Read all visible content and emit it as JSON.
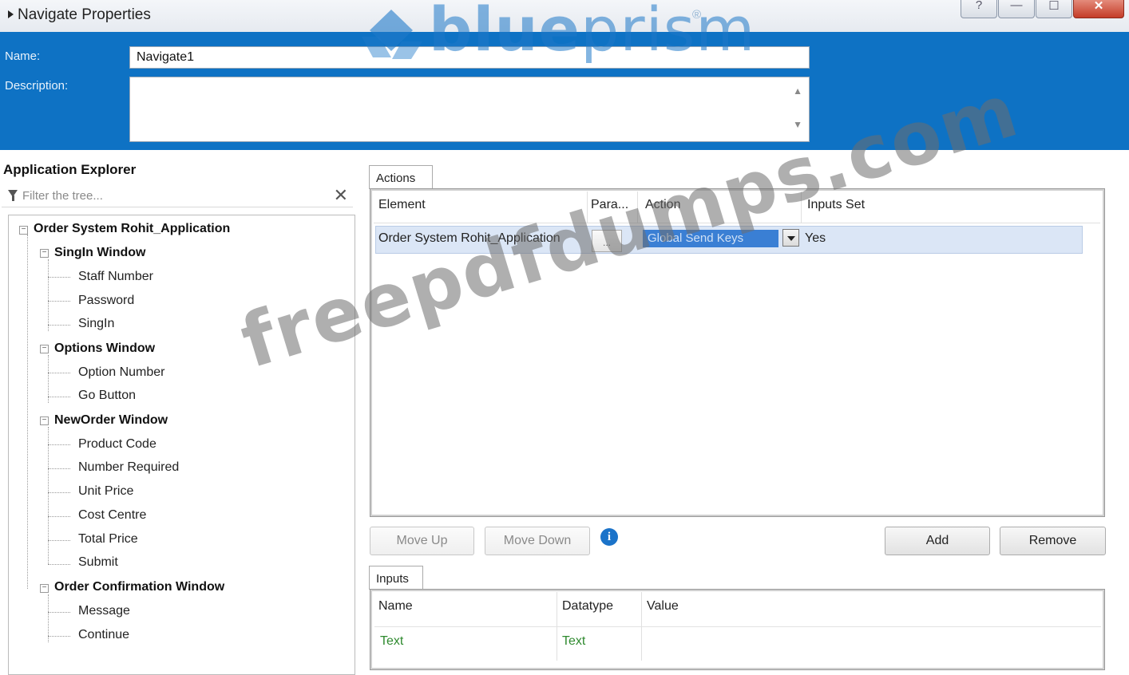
{
  "window": {
    "title": "Navigate Properties",
    "buttons": {
      "help": "?",
      "minimize": "—",
      "maximize": "☐",
      "close": "✕"
    }
  },
  "header": {
    "name_label": "Name:",
    "name_value": "Navigate1",
    "description_label": "Description:",
    "description_value": "",
    "logo": {
      "part1": "blue",
      "part2": "prism",
      "reg": "®"
    }
  },
  "explorer": {
    "title": "Application Explorer",
    "filter_placeholder": "Filter the tree...",
    "filter_clear": "✕",
    "root": "Order System Rohit_Application",
    "groups": [
      {
        "label": "SingIn Window",
        "children": [
          "Staff Number",
          "Password",
          "SingIn"
        ]
      },
      {
        "label": "Options Window",
        "children": [
          "Option Number",
          "Go Button"
        ]
      },
      {
        "label": "NewOrder Window",
        "children": [
          "Product Code",
          "Number Required",
          "Unit Price",
          "Cost Centre",
          "Total Price",
          "Submit"
        ]
      },
      {
        "label": "Order Confirmation Window",
        "children": [
          "Message",
          "Continue"
        ]
      }
    ]
  },
  "actions": {
    "tab": "Actions",
    "columns": [
      "Element",
      "Para...",
      "Action",
      "Inputs Set"
    ],
    "rows": [
      {
        "element": "Order System Rohit_Application",
        "params": "...",
        "action": "Global Send Keys",
        "inputs_set": "Yes"
      }
    ],
    "move_up": "Move Up",
    "move_down": "Move Down",
    "info": "i",
    "add": "Add",
    "remove": "Remove"
  },
  "inputs": {
    "tab": "Inputs",
    "columns": [
      "Name",
      "Datatype",
      "Value"
    ],
    "rows": [
      {
        "name": "Text",
        "datatype": "Text",
        "value": ""
      }
    ]
  },
  "watermark": "freepdfdumps.com",
  "colors": {
    "header_blue": "#0e72c4",
    "selection": "#dbe6f6",
    "combo_blue": "#3a7fd4",
    "info_blue": "#1b73c9",
    "green_text": "#2f8a2f"
  }
}
